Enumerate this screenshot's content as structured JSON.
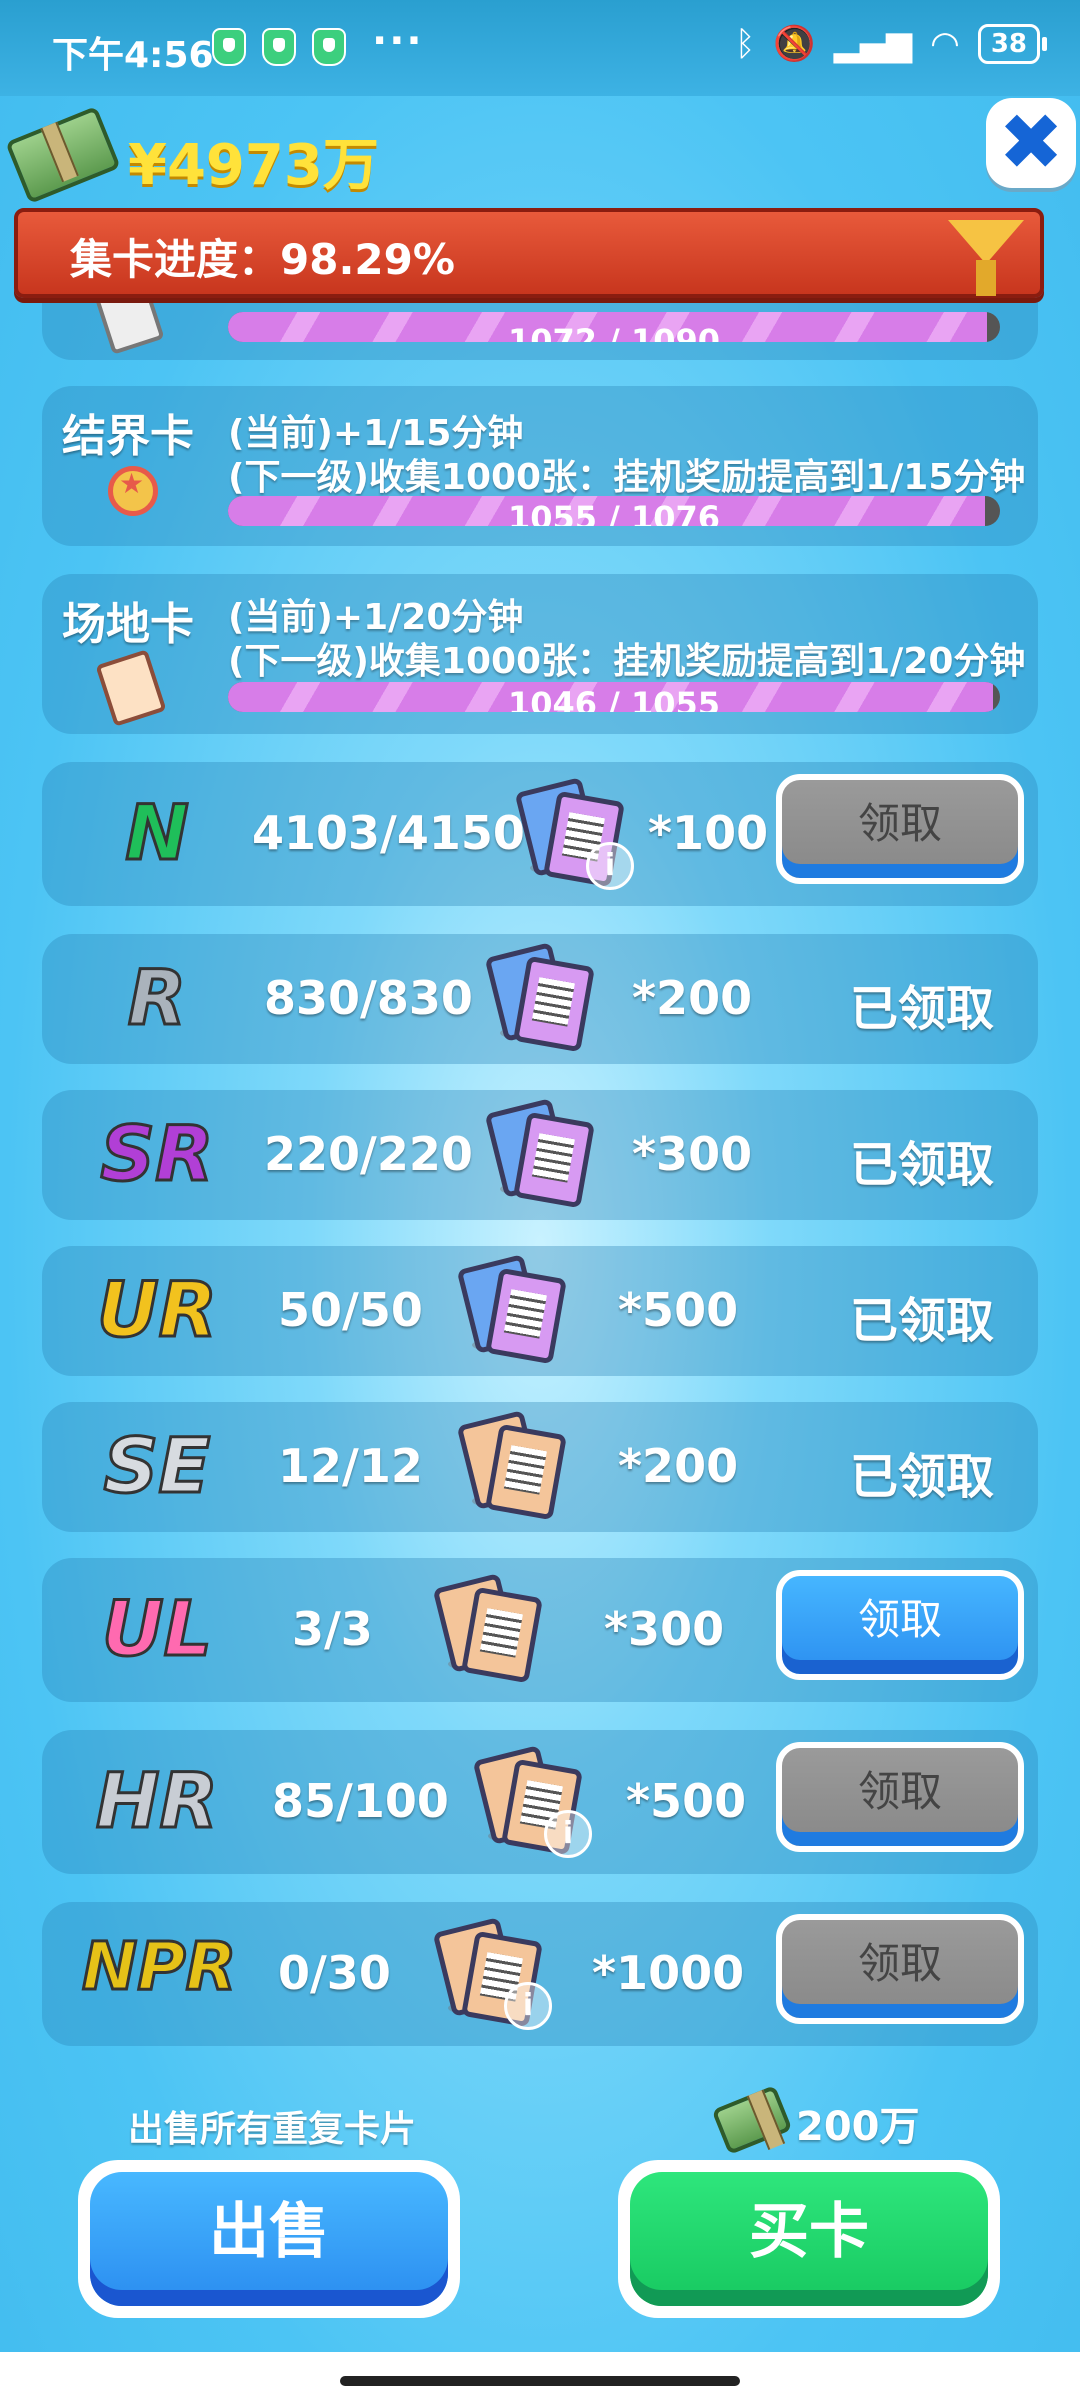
{
  "status_bar": {
    "time": "下午4:56",
    "more": "···",
    "battery": "38"
  },
  "header": {
    "money": "¥4973万",
    "close_symbol": "✖"
  },
  "banner": {
    "progress_text": "集卡进度：98.29%"
  },
  "upper_panels": [
    {
      "progress": {
        "text": "1072 / 1090",
        "value": 1072,
        "max": 1090
      }
    },
    {
      "name": "结界卡",
      "line1": "(当前)+1/15分钟",
      "line2": "(下一级)收集1000张：挂机奖励提高到1/15分钟",
      "progress": {
        "text": "1055 / 1076",
        "value": 1055,
        "max": 1076
      }
    },
    {
      "name": "场地卡",
      "line1": "(当前)+1/20分钟",
      "line2": "(下一级)收集1000张：挂机奖励提高到1/20分钟",
      "progress": {
        "text": "1046 / 1055",
        "value": 1046,
        "max": 1055
      }
    }
  ],
  "rows": [
    {
      "rarity": "N",
      "count": "4103/4150",
      "reward": "*100",
      "action": "领取",
      "state": "disabled",
      "color": "#1fbf5a"
    },
    {
      "rarity": "R",
      "count": "830/830",
      "reward": "*200",
      "action": "已领取",
      "state": "claimed",
      "color": "#aab3bc"
    },
    {
      "rarity": "SR",
      "count": "220/220",
      "reward": "*300",
      "action": "已领取",
      "state": "claimed",
      "color": "#b13fd6"
    },
    {
      "rarity": "UR",
      "count": "50/50",
      "reward": "*500",
      "action": "已领取",
      "state": "claimed",
      "color": "#f2c21e"
    },
    {
      "rarity": "SE",
      "count": "12/12",
      "reward": "*200",
      "action": "已领取",
      "state": "claimed",
      "color": "#d7dbe0"
    },
    {
      "rarity": "UL",
      "count": "3/3",
      "reward": "*300",
      "action": "领取",
      "state": "active",
      "color": "#ff6ab0"
    },
    {
      "rarity": "HR",
      "count": "85/100",
      "reward": "*500",
      "action": "领取",
      "state": "disabled",
      "color": "#c8cdd4"
    },
    {
      "rarity": "NPR",
      "count": "0/30",
      "reward": "*1000",
      "action": "领取",
      "state": "disabled",
      "color": "#e6c218"
    }
  ],
  "footer": {
    "sell_label": "出售所有重复卡片",
    "price": "200万",
    "sell_button": "出售",
    "buy_button": "买卡"
  }
}
